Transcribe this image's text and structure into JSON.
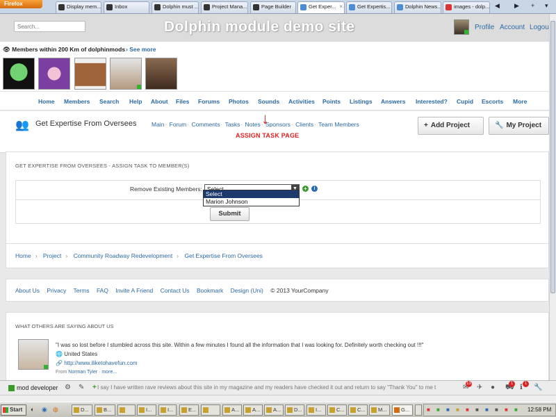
{
  "browser": {
    "firefox_label": "Firefox",
    "tabs": [
      {
        "label": "Display mem..."
      },
      {
        "label": "Inbox"
      },
      {
        "label": "Dolphin must ..."
      },
      {
        "label": "Project Mana..."
      },
      {
        "label": "Page Builder"
      },
      {
        "label": "Get Exper..."
      },
      {
        "label": "Get Expertis..."
      },
      {
        "label": "Dolphin News..."
      },
      {
        "label": "images - dolp..."
      }
    ]
  },
  "header": {
    "search_placeholder": "Search...",
    "site_title": "Dolphin module demo site",
    "profile": "Profile",
    "account": "Account",
    "logout": "Logou"
  },
  "members": {
    "title": "Members within 200 Km of dolphinmods",
    "see_more": "See more"
  },
  "nav": [
    "Home",
    "Members",
    "Search",
    "Help",
    "About",
    "Files",
    "Forums",
    "Photos",
    "Sounds",
    "Activities",
    "Points",
    "Listings",
    "Answers",
    "Interested?",
    "Cupid",
    "Escorts",
    "More"
  ],
  "project": {
    "title": "Get Expertise From Oversees",
    "submenu": [
      "Main",
      "Forum",
      "Comments",
      "Tasks",
      "Notes",
      "Sponsors",
      "Clients",
      "Team Members"
    ],
    "add_project": "Add Project",
    "my_project": "My Project"
  },
  "annotation": {
    "label": "ASSIGN TASK PAGE",
    "color": "#e02020"
  },
  "form": {
    "section_title": "GET EXPERTISE FROM OVERSEES - ASSIGN TASK TO MEMBER(S)",
    "label": "Remove Existing Members:",
    "selected": "Select",
    "options": [
      "Select",
      "Marion Johnson"
    ],
    "submit": "Submit"
  },
  "breadcrumb": [
    "Home",
    "Project",
    "Community Roadway Redevelopment",
    "Get Expertise From Oversees"
  ],
  "footer": {
    "links": [
      "About Us",
      "Privacy",
      "Terms",
      "FAQ",
      "Invite A Friend",
      "Contact Us",
      "Bookmark",
      "Design (Uni)"
    ],
    "copyright": "© 2013 YourCompany"
  },
  "testimonials": {
    "title": "WHAT OTHERS ARE SAYING ABOUT US",
    "quote": "\"I was so lost before I stumbled across this site. Within a few minutes I found all the information that I was looking for. Definitely worth checking out !!!\"",
    "country": "United States",
    "url": "http://www.iliketohavefun.com",
    "from_prefix": "From",
    "from_name": "Norman Tyler",
    "more": "more...",
    "quote2": "I say I have written rave reviews about this site in my magazine and my readers have checked it out and return to say \"Thank You\" to me t"
  },
  "toolbar": {
    "label": "mod developer",
    "badge_mail": "13",
    "badge_cart": "1",
    "badge_info": "1"
  },
  "taskbar": {
    "start": "Start",
    "items": [
      "D...",
      "B...",
      "I...",
      "I...",
      "E...",
      "A...",
      "A...",
      "A...",
      "D...",
      "I...",
      "C...",
      "C...",
      "M...",
      "G...",
      "t..."
    ],
    "clock": "12:58 PM"
  }
}
